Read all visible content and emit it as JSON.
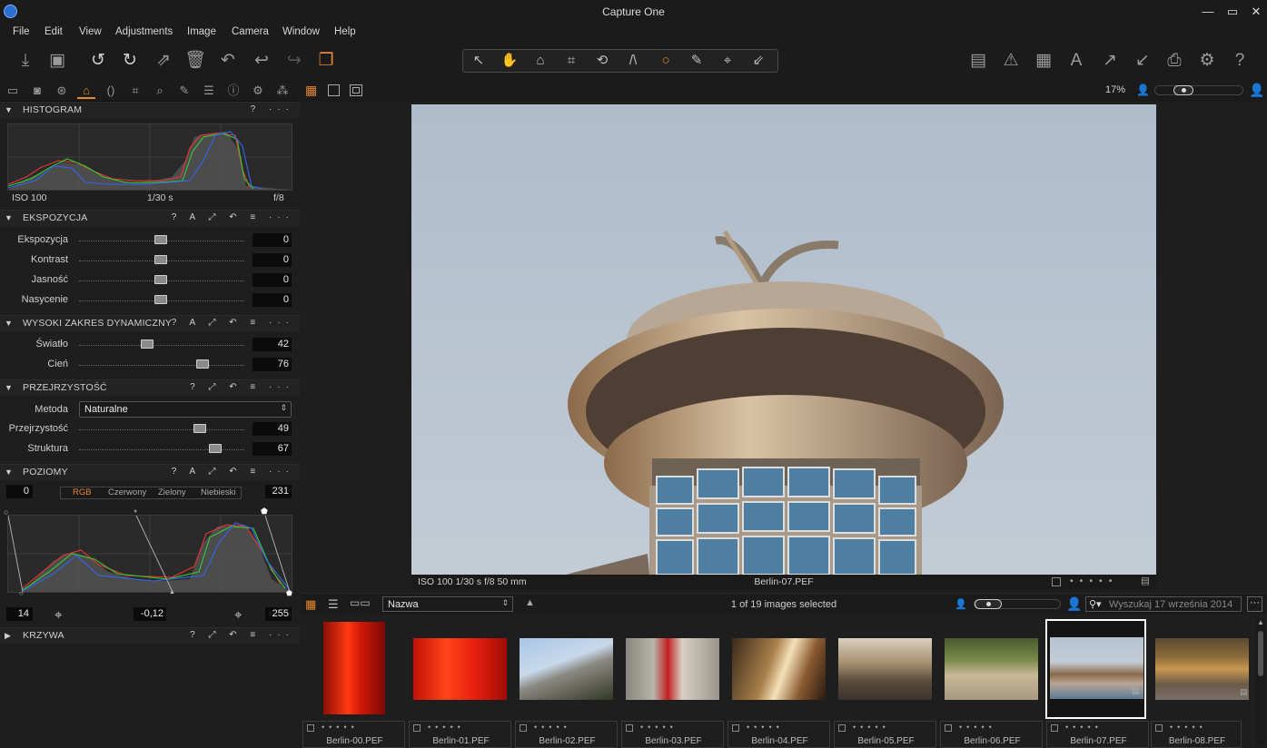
{
  "window": {
    "title": "Capture One",
    "minimize": "—",
    "maximize": "▭",
    "close": "✕"
  },
  "menu": [
    "File",
    "Edit",
    "View",
    "Adjustments",
    "Image",
    "Camera",
    "Window",
    "Help"
  ],
  "viewer": {
    "zoom": "17%",
    "info_left": "ISO 100 1/30 s f/8 50 mm",
    "filename": "Berlin-07.PEF"
  },
  "histogram": {
    "title": "HISTOGRAM",
    "iso": "ISO 100",
    "shutter": "1/30 s",
    "aperture": "f/8",
    "help": "?",
    "more": "···"
  },
  "exposure": {
    "title": "EKSPOZYCJA",
    "sliders": [
      {
        "label": "Ekspozycja",
        "value": "0"
      },
      {
        "label": "Kontrast",
        "value": "0"
      },
      {
        "label": "Jasność",
        "value": "0"
      },
      {
        "label": "Nasycenie",
        "value": "0"
      }
    ]
  },
  "hdr": {
    "title": "WYSOKI ZAKRES DYNAMICZNY",
    "sliders": [
      {
        "label": "Światło",
        "value": "42"
      },
      {
        "label": "Cień",
        "value": "76"
      }
    ]
  },
  "clarity": {
    "title": "PRZEJRZYSTOŚĆ",
    "method_label": "Metoda",
    "method_value": "Naturalne",
    "sliders": [
      {
        "label": "Przejrzystość",
        "value": "49"
      },
      {
        "label": "Struktura",
        "value": "67"
      }
    ]
  },
  "levels": {
    "title": "POZIOMY",
    "input_low": "0",
    "input_high": "231",
    "channels": [
      "RGB",
      "Czerwony",
      "Zielony",
      "Niebieski"
    ],
    "output_low": "14",
    "midpoint": "-0,12",
    "output_high": "255"
  },
  "curve": {
    "title": "KRZYWA"
  },
  "browser": {
    "sort": "Nazwa",
    "selected_text": "1 of 19 images selected",
    "search_placeholder": "Wyszukaj 17 września 2014",
    "thumbs": [
      "Berlin-00.PEF",
      "Berlin-01.PEF",
      "Berlin-02.PEF",
      "Berlin-03.PEF",
      "Berlin-04.PEF",
      "Berlin-05.PEF",
      "Berlin-06.PEF",
      "Berlin-07.PEF",
      "Berlin-08.PEF"
    ]
  },
  "colors": {
    "accent": "#e8872c",
    "panel": "#1e1e1e"
  }
}
